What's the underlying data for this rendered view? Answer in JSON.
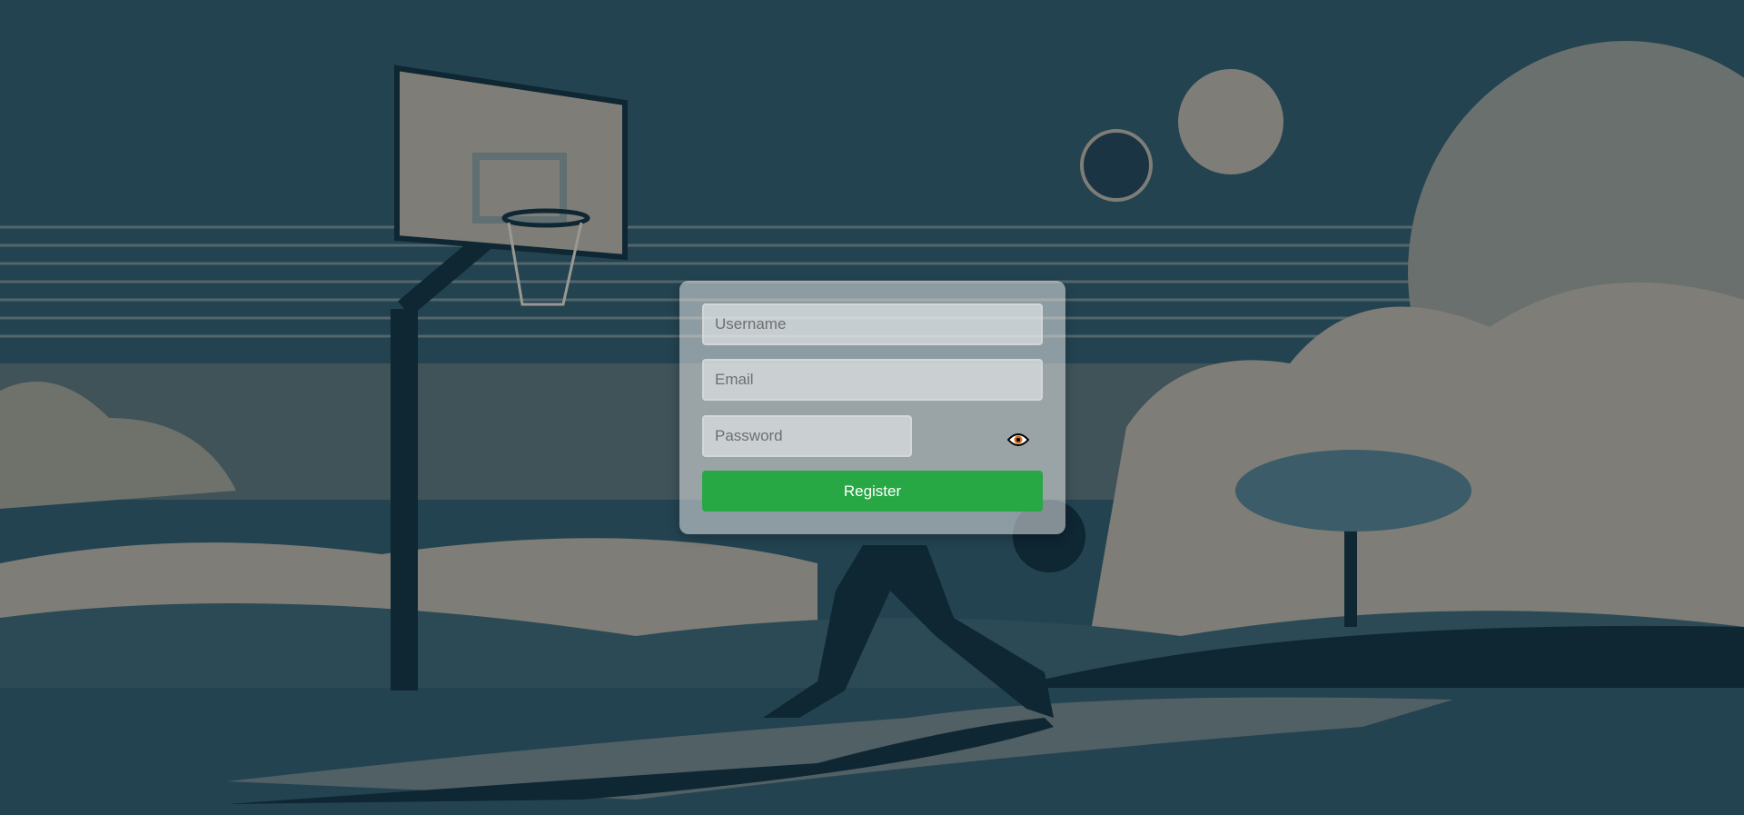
{
  "form": {
    "username_placeholder": "Username",
    "email_placeholder": "Email",
    "password_placeholder": "Password",
    "toggle_password_icon": "eye-icon",
    "register_label": "Register"
  },
  "colors": {
    "accent": "#28a745",
    "background_sky": "#234350",
    "background_dark": "#0f2633"
  }
}
